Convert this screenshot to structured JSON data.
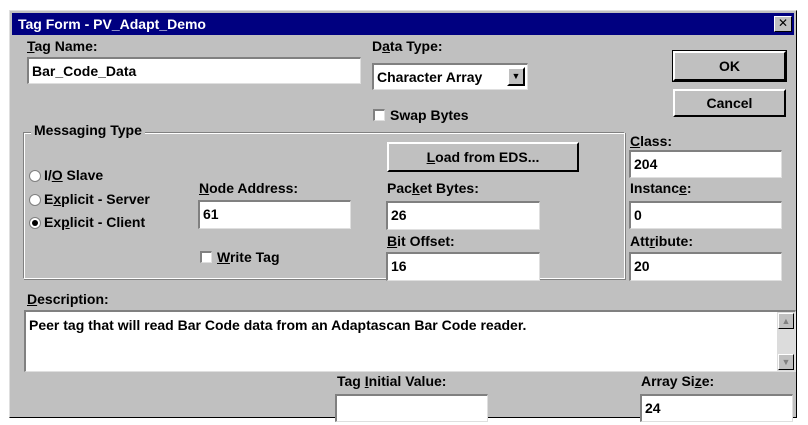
{
  "window": {
    "title": "Tag Form - PV_Adapt_Demo",
    "close_glyph": "✕"
  },
  "tag_name": {
    "label_accel": "T",
    "label_rest": "ag Name:",
    "value": "Bar_Code_Data"
  },
  "data_type": {
    "label_pre": "D",
    "label_accel": "a",
    "label_rest": "ta Type:",
    "selected": "Character Array",
    "arrow": "▼"
  },
  "swap_bytes": {
    "label": "Swap Bytes",
    "checked": false
  },
  "buttons": {
    "ok": "OK",
    "cancel": "Cancel"
  },
  "messaging": {
    "title": "Messaging Type",
    "options": [
      {
        "pre": "I/",
        "accel": "O",
        "post": " Slave",
        "selected": false
      },
      {
        "pre": "E",
        "accel": "x",
        "post": "plicit - Server",
        "selected": false
      },
      {
        "pre": "Ex",
        "accel": "p",
        "post": "licit - Client",
        "selected": true
      }
    ]
  },
  "node_address": {
    "label_accel": "N",
    "label_rest": "ode Address:",
    "value": "61"
  },
  "write_tag": {
    "label_accel": "W",
    "label_rest": "rite Tag",
    "checked": false
  },
  "load_eds": {
    "label_accel": "L",
    "label_rest": "oad from EDS..."
  },
  "packet_bytes": {
    "label_pre": "Pac",
    "label_accel": "k",
    "label_rest": "et Bytes:",
    "value": "26"
  },
  "bit_offset": {
    "label_accel": "B",
    "label_rest": "it Offset:",
    "value": "16"
  },
  "class": {
    "label_accel": "C",
    "label_rest": "lass:",
    "value": "204"
  },
  "instance": {
    "label_pre": "Instanc",
    "label_accel": "e",
    "label_rest": ":",
    "value": "0"
  },
  "attribute": {
    "label_pre": "Att",
    "label_accel": "r",
    "label_rest": "ibute:",
    "value": "20"
  },
  "description": {
    "label_accel": "D",
    "label_rest": "escription:",
    "value": "Peer tag that will read Bar Code data from an Adaptascan Bar Code reader."
  },
  "tag_initial_value": {
    "label_pre": "Tag ",
    "label_accel": "I",
    "label_rest": "nitial Value:",
    "value": ""
  },
  "array_size": {
    "label_pre": "Array Si",
    "label_accel": "z",
    "label_rest": "e:",
    "value": "24"
  }
}
